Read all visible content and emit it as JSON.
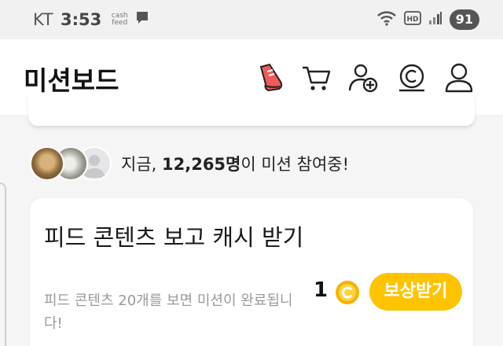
{
  "status_bar": {
    "carrier": "KT",
    "time": "3:53",
    "cashfeed_line1": "cash",
    "cashfeed_line2": "feed",
    "battery": "91",
    "icons": [
      "message-icon",
      "wifi-icon",
      "hd-voice-icon",
      "signal-icon",
      "battery-icon"
    ]
  },
  "header": {
    "title": "미션보드",
    "icons": [
      "shoe-icon",
      "cart-icon",
      "add-friend-icon",
      "coin-history-icon",
      "profile-icon"
    ]
  },
  "participants": {
    "prefix": "지금, ",
    "count": "12,265명",
    "suffix": "이 미션 참여중!"
  },
  "mission": {
    "title": "피드 콘텐츠 보고 캐시 받기",
    "description": "피드 콘텐츠 20개를 보면 미션이 완료됩니다!",
    "reward_amount": "1",
    "reward_button": "보상받기"
  },
  "colors": {
    "accent": "#ffc300",
    "coin": "#f5b400",
    "page_background": "#f5f5f6",
    "card_background": "#ffffff"
  }
}
